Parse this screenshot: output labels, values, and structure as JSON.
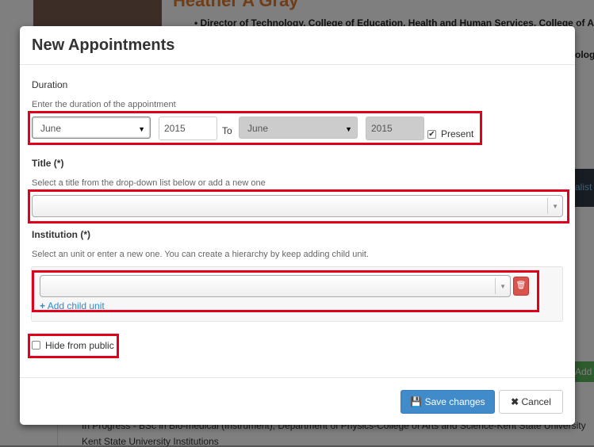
{
  "background": {
    "name": "Heather A Gray",
    "subtitle": "Director of Technology, College of Education, Health and Human Services, College of Applied",
    "subtitle2": "ology",
    "bar_text": "alist",
    "green_text": "Add",
    "bottom1": "In Progress - BSc in Bio-medical (Instrument), Department of Physics-College of Arts and Science-Kent State University",
    "bottom2": "Kent State University Institutions"
  },
  "modal": {
    "title": "New Appointments",
    "duration_label": "Duration",
    "duration_help": "Enter the duration of the appointment",
    "from_month": "June",
    "from_year": "2015",
    "to_label": "To",
    "to_month": "June",
    "to_year": "2015",
    "present_label": "Present",
    "present_checked": true,
    "title_label": "Title (*)",
    "title_help": "Select a title from the drop-down list below or add a new one",
    "title_value": "",
    "institution_label": "Institution (*)",
    "institution_help": "Select an unit or enter a new one. You can create a hierarchy by keep adding child unit.",
    "institution_value": "",
    "add_child_label": "Add child unit",
    "hide_label": "Hide from public",
    "hide_checked": false,
    "save_label": "Save changes",
    "cancel_label": "Cancel"
  },
  "colors": {
    "highlight": "#e0001b",
    "primary": "#428bca",
    "danger": "#d9534f",
    "link": "#2a8ecf"
  },
  "icons": {
    "present_check": "checkmark",
    "delete": "trash-icon",
    "add": "plus-icon",
    "save": "floppy-disk-icon",
    "cancel": "close-icon"
  }
}
